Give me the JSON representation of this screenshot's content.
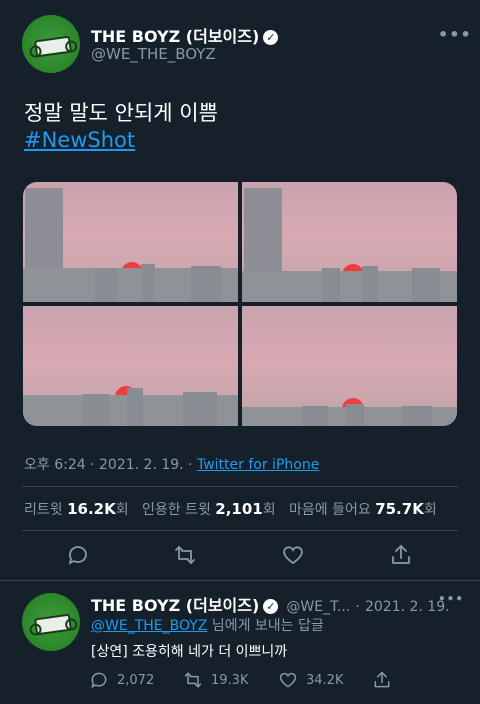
{
  "tweet": {
    "display_name": "THE BOYZ (더보이즈)",
    "handle": "@WE_THE_BOYZ",
    "more_label": "•••",
    "text": "정말 말도 안되게 이쁨",
    "hashtag": "#NewShot",
    "time": "오후 6:24",
    "date": "2021. 2. 19.",
    "separator": "·",
    "source": "Twitter for iPhone",
    "stats": {
      "retweets_label": "리트윗",
      "retweets_value": "16.2K",
      "retweets_unit": "회",
      "quotes_label": "인용한 트윗",
      "quotes_value": "2,101",
      "quotes_unit": "회",
      "likes_label": "마음에 들어요",
      "likes_value": "75.7K",
      "likes_unit": "회"
    },
    "actions": [
      "reply-icon",
      "retweet-icon",
      "like-icon",
      "share-icon"
    ],
    "photos": [
      "photo-1",
      "photo-2",
      "photo-3",
      "photo-4"
    ]
  },
  "reply": {
    "display_name": "THE BOYZ (더보이즈)",
    "handle": "@WE_T...",
    "separator": "·",
    "date": "2021. 2. 19.",
    "more_label": "•••",
    "mention": "@WE_THE_BOYZ",
    "replying_suffix": " 님에게 보내는 답글",
    "text": "[상연] 조용히해 네가 더 이쁘니까",
    "reply_count": "2,072",
    "retweet_count": "19.3K",
    "like_count": "34.2K"
  },
  "colors": {
    "background": "#15202b",
    "accent": "#1d9bf0",
    "secondary_text": "#8b98a5",
    "divider": "#38444d"
  }
}
